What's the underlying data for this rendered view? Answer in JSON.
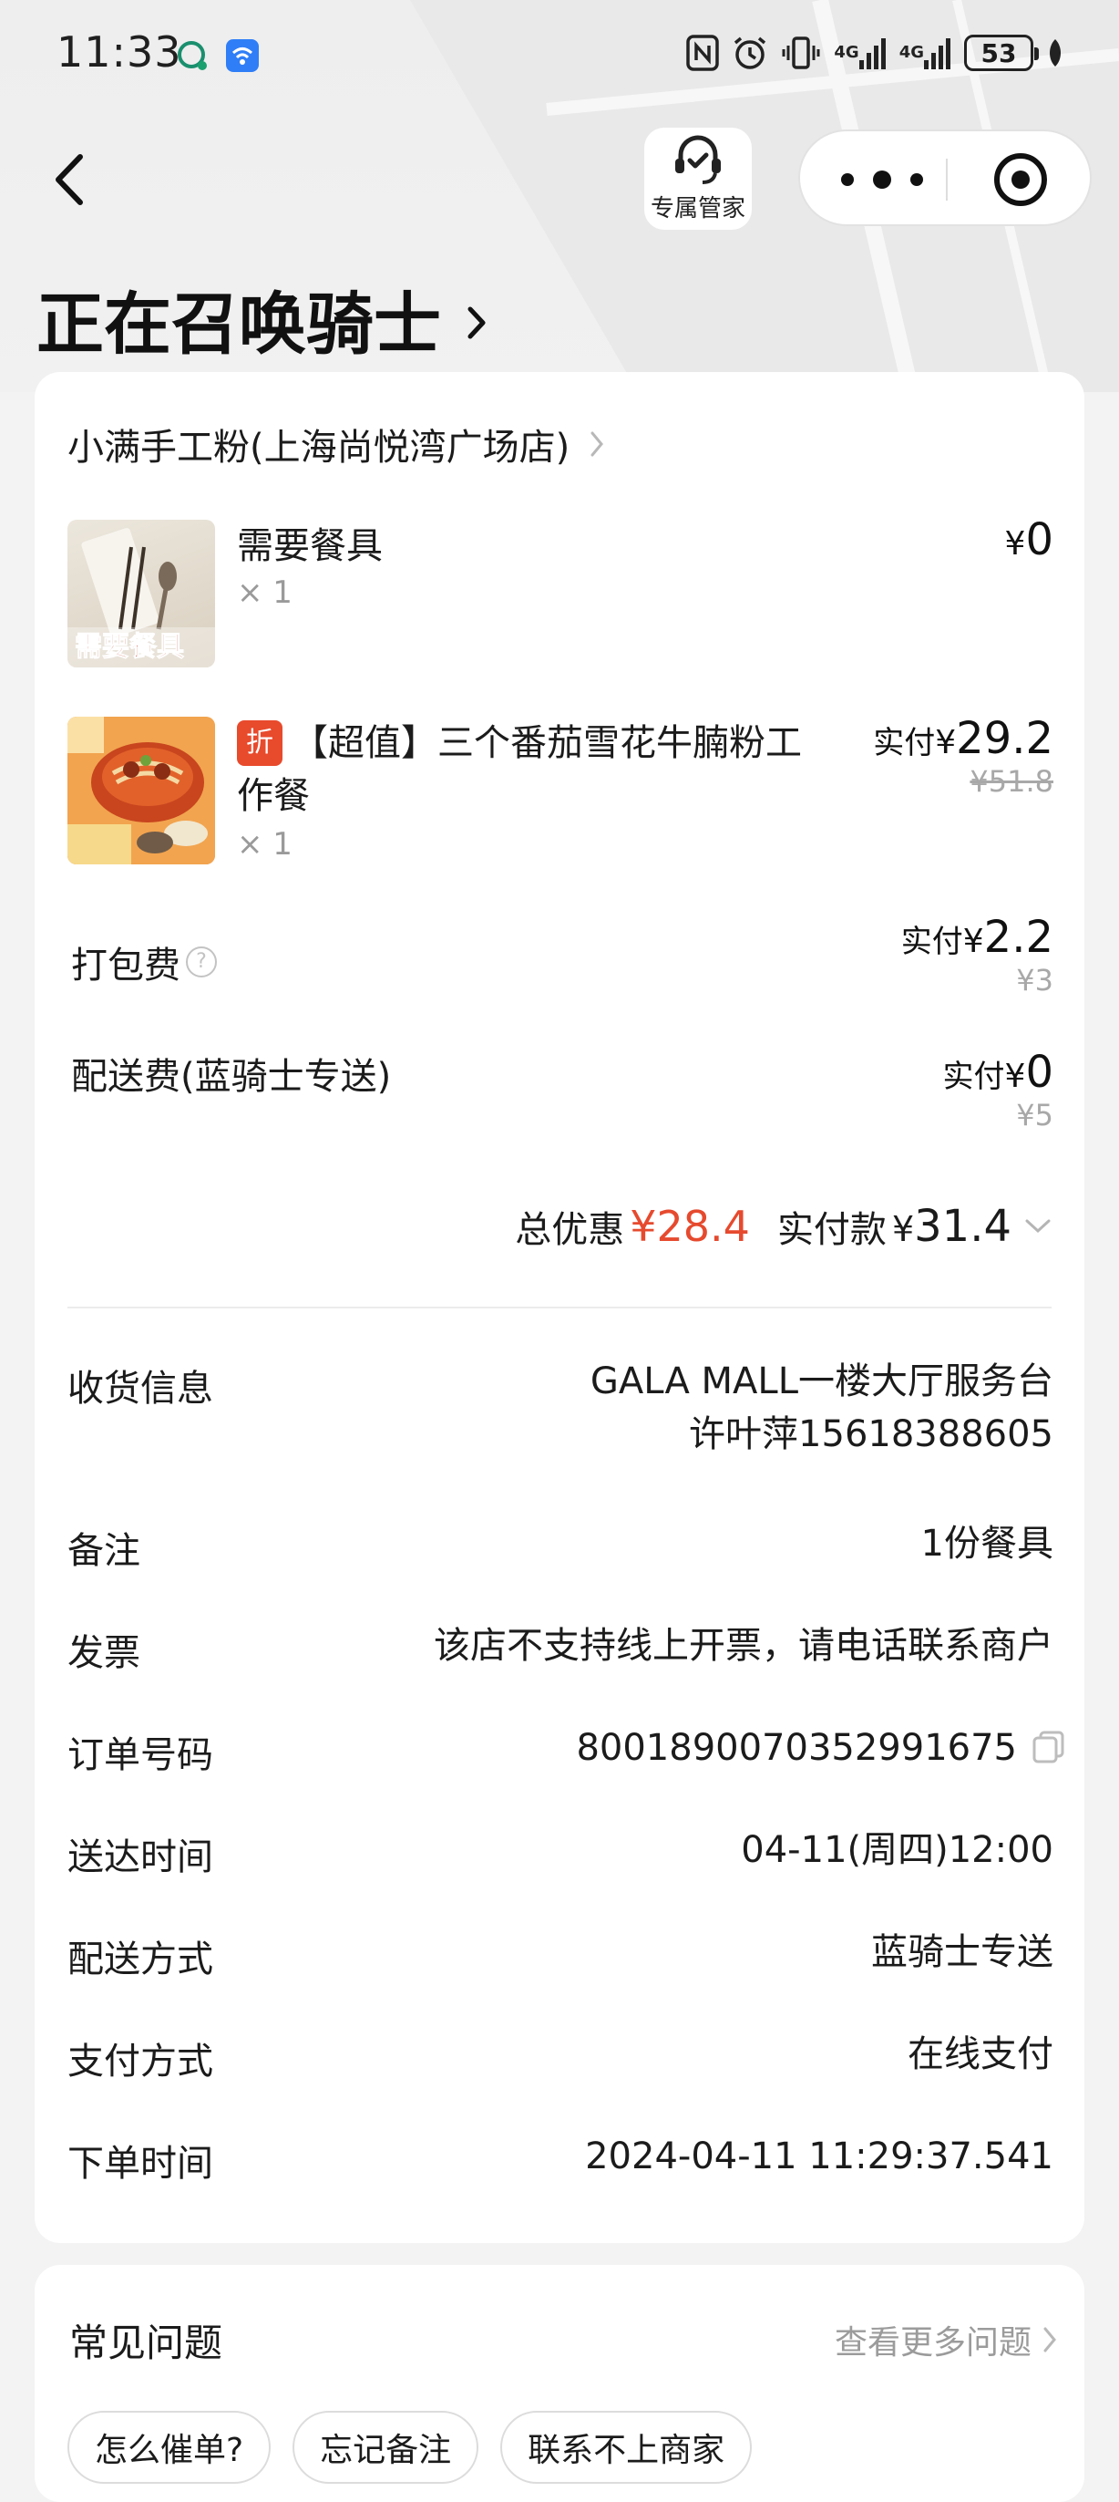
{
  "status_bar": {
    "time": "11:33",
    "network_a": "4G",
    "network_b": "4G",
    "battery": "53",
    "icons": [
      "chat-icon",
      "wifi-app-icon",
      "nfc-icon",
      "alarm-icon",
      "vibrate-icon",
      "signal-icon",
      "battery-icon",
      "leaf-icon"
    ]
  },
  "nav": {
    "back_icon": "chevron-left-icon",
    "service_label": "专属管家",
    "more_icon": "more-dots-icon",
    "close_icon": "target-icon"
  },
  "page_title": "正在召唤骑士",
  "order": {
    "shop_name": "小满手工粉(上海尚悦湾广场店)",
    "items": [
      {
        "name": "需要餐具",
        "qty": "× 1",
        "price_currency": "¥",
        "price": "0",
        "thumb_text": "需要餐具"
      },
      {
        "badge": "折",
        "name": "【超值】三个番茄雪花牛腩粉工作餐",
        "qty": "× 1",
        "price_prefix": "实付",
        "price_currency": "¥",
        "price": "29.2",
        "original_price": "¥51.8"
      }
    ],
    "fees": [
      {
        "label": "打包费",
        "price_prefix": "实付",
        "price_currency": "¥",
        "price": "2.2",
        "original": "¥3"
      },
      {
        "label": "配送费(蓝骑士专送)",
        "price_prefix": "实付",
        "price_currency": "¥",
        "price": "0",
        "original": "¥5"
      }
    ],
    "total": {
      "discount_label": "总优惠",
      "discount_value": "¥28.4",
      "paid_label": "实付款",
      "paid_currency": "¥",
      "paid_value": "31.4"
    },
    "details": [
      {
        "label": "收货信息",
        "value_line1": "GALA MALL一楼大厅服务台",
        "value_line2": "许叶萍15618388605"
      },
      {
        "label": "备注",
        "value": "1份餐具"
      },
      {
        "label": "发票",
        "value": "该店不支持线上开票，请电话联系商户"
      },
      {
        "label": "订单号码",
        "value": "8001890070352991675"
      },
      {
        "label": "送达时间",
        "value": "04-11(周四)12:00"
      },
      {
        "label": "配送方式",
        "value": "蓝骑士专送"
      },
      {
        "label": "支付方式",
        "value": "在线支付"
      },
      {
        "label": "下单时间",
        "value": "2024-04-11 11:29:37.541"
      }
    ]
  },
  "faq": {
    "title": "常见问题",
    "more": "查看更多问题",
    "chips": [
      "怎么催单?",
      "忘记备注",
      "联系不上商家"
    ]
  },
  "colors": {
    "accent_red": "#e64a2e",
    "badge_red": "#e84a2c",
    "muted": "#a8a8a8"
  }
}
